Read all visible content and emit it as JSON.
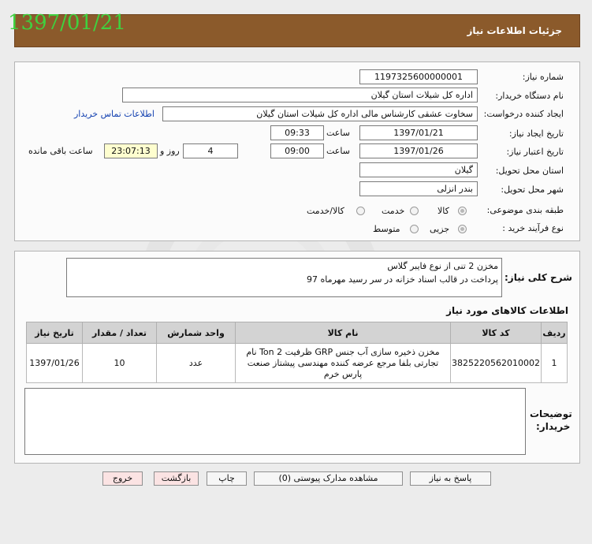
{
  "date_stamp": "1397/01/21",
  "header": {
    "title": "جزئیات اطلاعات نیاز"
  },
  "form": {
    "need_number": {
      "label": "شماره نیاز:",
      "value": "1197325600000001"
    },
    "buyer_org": {
      "label": "نام دستگاه خریدار:",
      "value": "اداره کل شیلات استان گیلان"
    },
    "requester": {
      "label": "ایجاد کننده درخواست:",
      "value": "سخاوت  عشقی  کارشناس مالی  اداره کل شیلات استان گیلان",
      "contact_link": "اطلاعات تماس خریدار"
    },
    "created": {
      "label": "تاریخ ایجاد نیاز:",
      "date": "1397/01/21",
      "time_label": "ساعت",
      "time": "09:33"
    },
    "validity": {
      "label": "تاریخ اعتبار نیاز:",
      "date": "1397/01/26",
      "time_label": "ساعت",
      "time": "09:00",
      "days": "4",
      "days_label": "روز و",
      "remaining": "23:07:13",
      "remaining_label": "ساعت باقی مانده"
    },
    "province": {
      "label": "استان محل تحویل:",
      "value": "گیلان"
    },
    "city": {
      "label": "شهر محل تحویل:",
      "value": "بندر انزلی"
    },
    "category": {
      "label": "طبقه بندی موضوعی:",
      "options": [
        "کالا",
        "خدمت",
        "کالا/خدمت"
      ],
      "selected": "کالا"
    },
    "purchase_type": {
      "label": "نوع فرآیند خرید :",
      "options": [
        "جزیی",
        "متوسط"
      ],
      "selected": "جزیی"
    }
  },
  "description": {
    "label": "شرح کلی نیاز:",
    "line1": "مخزن 2 تنی از نوع فایبر گلاس",
    "line2": "پرداخت در قالب اسناد خزانه در سر رسید مهرماه 97"
  },
  "goods": {
    "title": "اطلاعات کالاهای مورد نیاز",
    "columns": [
      "ردیف",
      "کد کالا",
      "نام کالا",
      "واحد شمارش",
      "تعداد / مقدار",
      "تاریخ نیاز"
    ],
    "rows": [
      {
        "row": "1",
        "code": "3825220562010002",
        "name_line1": "مخزن ذخیره سازی آب جنس GRP ظرفیت 2 Ton نام",
        "name_line2": "تجارتی بلفا مرجع عرضه کننده مهندسی پیشتاز صنعت",
        "name_line3": "پارس خرم",
        "unit": "عدد",
        "qty": "10",
        "date": "1397/01/26"
      }
    ]
  },
  "notes": {
    "label_line1": "توضیحات",
    "label_line2": "خریدار:"
  },
  "buttons": {
    "reply": "پاسخ به نیاز",
    "attachments": "مشاهده مدارک پیوستی (0)",
    "print": "چاپ",
    "back": "بازگشت",
    "exit": "خروج"
  },
  "colors": {
    "header": "#8b5a2b",
    "date_stamp": "#3fd13f",
    "table_header": "#d3d3d3"
  }
}
